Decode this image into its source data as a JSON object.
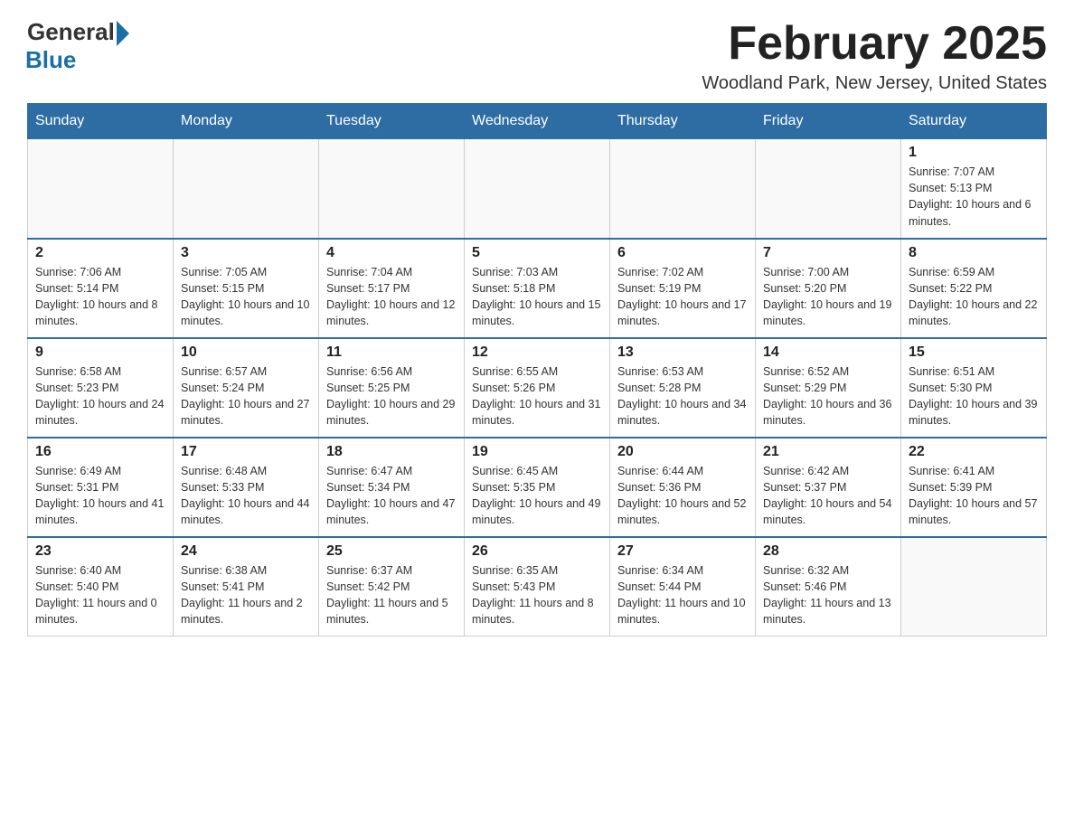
{
  "header": {
    "logo_general": "General",
    "logo_blue": "Blue",
    "month_title": "February 2025",
    "location": "Woodland Park, New Jersey, United States"
  },
  "days_of_week": [
    "Sunday",
    "Monday",
    "Tuesday",
    "Wednesday",
    "Thursday",
    "Friday",
    "Saturday"
  ],
  "weeks": [
    [
      {
        "day": "",
        "info": ""
      },
      {
        "day": "",
        "info": ""
      },
      {
        "day": "",
        "info": ""
      },
      {
        "day": "",
        "info": ""
      },
      {
        "day": "",
        "info": ""
      },
      {
        "day": "",
        "info": ""
      },
      {
        "day": "1",
        "info": "Sunrise: 7:07 AM\nSunset: 5:13 PM\nDaylight: 10 hours and 6 minutes."
      }
    ],
    [
      {
        "day": "2",
        "info": "Sunrise: 7:06 AM\nSunset: 5:14 PM\nDaylight: 10 hours and 8 minutes."
      },
      {
        "day": "3",
        "info": "Sunrise: 7:05 AM\nSunset: 5:15 PM\nDaylight: 10 hours and 10 minutes."
      },
      {
        "day": "4",
        "info": "Sunrise: 7:04 AM\nSunset: 5:17 PM\nDaylight: 10 hours and 12 minutes."
      },
      {
        "day": "5",
        "info": "Sunrise: 7:03 AM\nSunset: 5:18 PM\nDaylight: 10 hours and 15 minutes."
      },
      {
        "day": "6",
        "info": "Sunrise: 7:02 AM\nSunset: 5:19 PM\nDaylight: 10 hours and 17 minutes."
      },
      {
        "day": "7",
        "info": "Sunrise: 7:00 AM\nSunset: 5:20 PM\nDaylight: 10 hours and 19 minutes."
      },
      {
        "day": "8",
        "info": "Sunrise: 6:59 AM\nSunset: 5:22 PM\nDaylight: 10 hours and 22 minutes."
      }
    ],
    [
      {
        "day": "9",
        "info": "Sunrise: 6:58 AM\nSunset: 5:23 PM\nDaylight: 10 hours and 24 minutes."
      },
      {
        "day": "10",
        "info": "Sunrise: 6:57 AM\nSunset: 5:24 PM\nDaylight: 10 hours and 27 minutes."
      },
      {
        "day": "11",
        "info": "Sunrise: 6:56 AM\nSunset: 5:25 PM\nDaylight: 10 hours and 29 minutes."
      },
      {
        "day": "12",
        "info": "Sunrise: 6:55 AM\nSunset: 5:26 PM\nDaylight: 10 hours and 31 minutes."
      },
      {
        "day": "13",
        "info": "Sunrise: 6:53 AM\nSunset: 5:28 PM\nDaylight: 10 hours and 34 minutes."
      },
      {
        "day": "14",
        "info": "Sunrise: 6:52 AM\nSunset: 5:29 PM\nDaylight: 10 hours and 36 minutes."
      },
      {
        "day": "15",
        "info": "Sunrise: 6:51 AM\nSunset: 5:30 PM\nDaylight: 10 hours and 39 minutes."
      }
    ],
    [
      {
        "day": "16",
        "info": "Sunrise: 6:49 AM\nSunset: 5:31 PM\nDaylight: 10 hours and 41 minutes."
      },
      {
        "day": "17",
        "info": "Sunrise: 6:48 AM\nSunset: 5:33 PM\nDaylight: 10 hours and 44 minutes."
      },
      {
        "day": "18",
        "info": "Sunrise: 6:47 AM\nSunset: 5:34 PM\nDaylight: 10 hours and 47 minutes."
      },
      {
        "day": "19",
        "info": "Sunrise: 6:45 AM\nSunset: 5:35 PM\nDaylight: 10 hours and 49 minutes."
      },
      {
        "day": "20",
        "info": "Sunrise: 6:44 AM\nSunset: 5:36 PM\nDaylight: 10 hours and 52 minutes."
      },
      {
        "day": "21",
        "info": "Sunrise: 6:42 AM\nSunset: 5:37 PM\nDaylight: 10 hours and 54 minutes."
      },
      {
        "day": "22",
        "info": "Sunrise: 6:41 AM\nSunset: 5:39 PM\nDaylight: 10 hours and 57 minutes."
      }
    ],
    [
      {
        "day": "23",
        "info": "Sunrise: 6:40 AM\nSunset: 5:40 PM\nDaylight: 11 hours and 0 minutes."
      },
      {
        "day": "24",
        "info": "Sunrise: 6:38 AM\nSunset: 5:41 PM\nDaylight: 11 hours and 2 minutes."
      },
      {
        "day": "25",
        "info": "Sunrise: 6:37 AM\nSunset: 5:42 PM\nDaylight: 11 hours and 5 minutes."
      },
      {
        "day": "26",
        "info": "Sunrise: 6:35 AM\nSunset: 5:43 PM\nDaylight: 11 hours and 8 minutes."
      },
      {
        "day": "27",
        "info": "Sunrise: 6:34 AM\nSunset: 5:44 PM\nDaylight: 11 hours and 10 minutes."
      },
      {
        "day": "28",
        "info": "Sunrise: 6:32 AM\nSunset: 5:46 PM\nDaylight: 11 hours and 13 minutes."
      },
      {
        "day": "",
        "info": ""
      }
    ]
  ]
}
